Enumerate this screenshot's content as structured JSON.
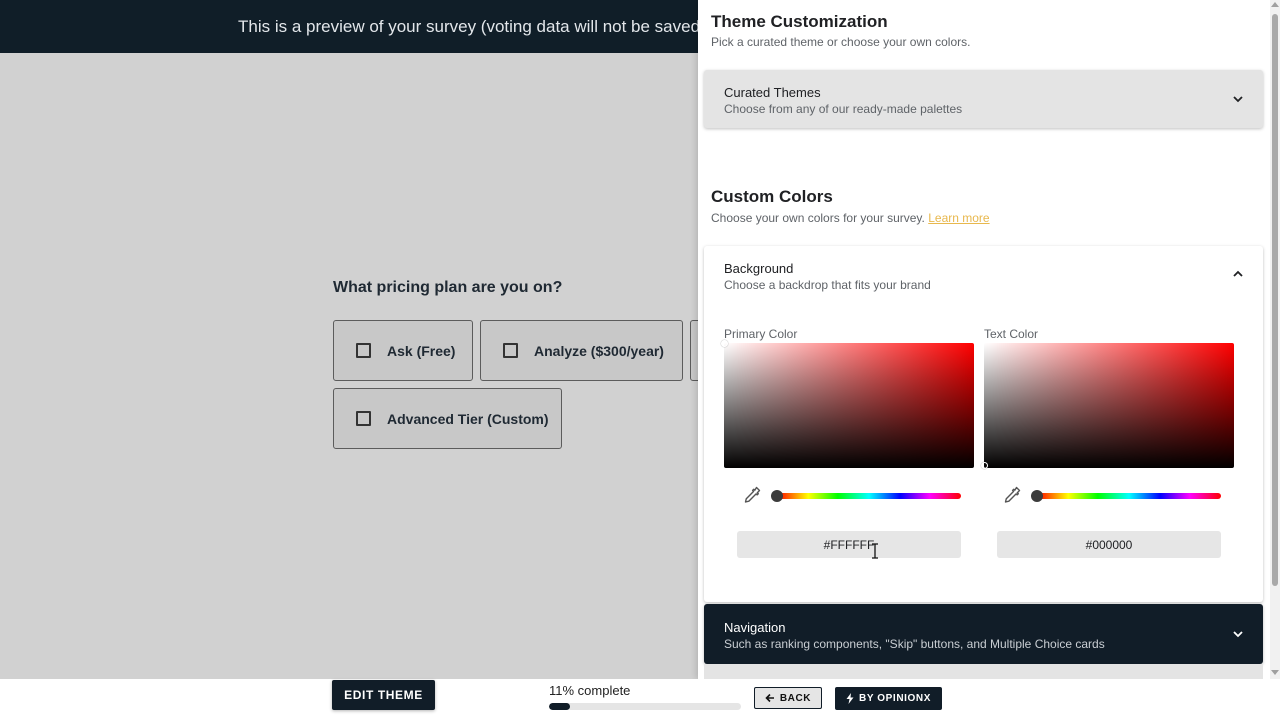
{
  "preview_banner": {
    "text": "This is a preview of your survey (voting data will not be saved)."
  },
  "survey": {
    "question": "What pricing plan are you on?",
    "options": [
      {
        "label": "Ask (Free)",
        "checked": false
      },
      {
        "label": "Analyze ($300/year)",
        "checked": false
      },
      {
        "label": "Advanced Tier (Custom)",
        "checked": false
      }
    ]
  },
  "theme_panel": {
    "title": "Theme Customization",
    "subtitle": "Pick a curated theme or choose your own colors.",
    "curated_themes": {
      "title": "Curated Themes",
      "subtitle": "Choose from any of our ready-made palettes",
      "expanded": false
    },
    "custom_colors": {
      "title": "Custom Colors",
      "subtitle": "Choose your own colors for your survey.",
      "learn_more": "Learn more"
    },
    "background": {
      "title": "Background",
      "subtitle": "Choose a backdrop that fits your brand",
      "expanded": true,
      "primary_color": {
        "label": "Primary Color",
        "value": "#FFFFFF",
        "hue": "#ff0000"
      },
      "text_color": {
        "label": "Text Color",
        "value": "#000000",
        "hue": "#ff0000"
      }
    },
    "navigation": {
      "title": "Navigation",
      "subtitle": "Such as ranking components, \"Skip\" buttons, and Multiple Choice cards",
      "expanded": false
    }
  },
  "bottom_bar": {
    "edit_theme": "EDIT THEME",
    "progress_label": "11% complete",
    "progress_value": 0.11,
    "back": "BACK",
    "opinionx": "BY OPINIONX"
  },
  "colors": {
    "dark_navy": "#111d28",
    "preview_background": "#d1d1d1",
    "accent_link": "#e8b84d"
  }
}
